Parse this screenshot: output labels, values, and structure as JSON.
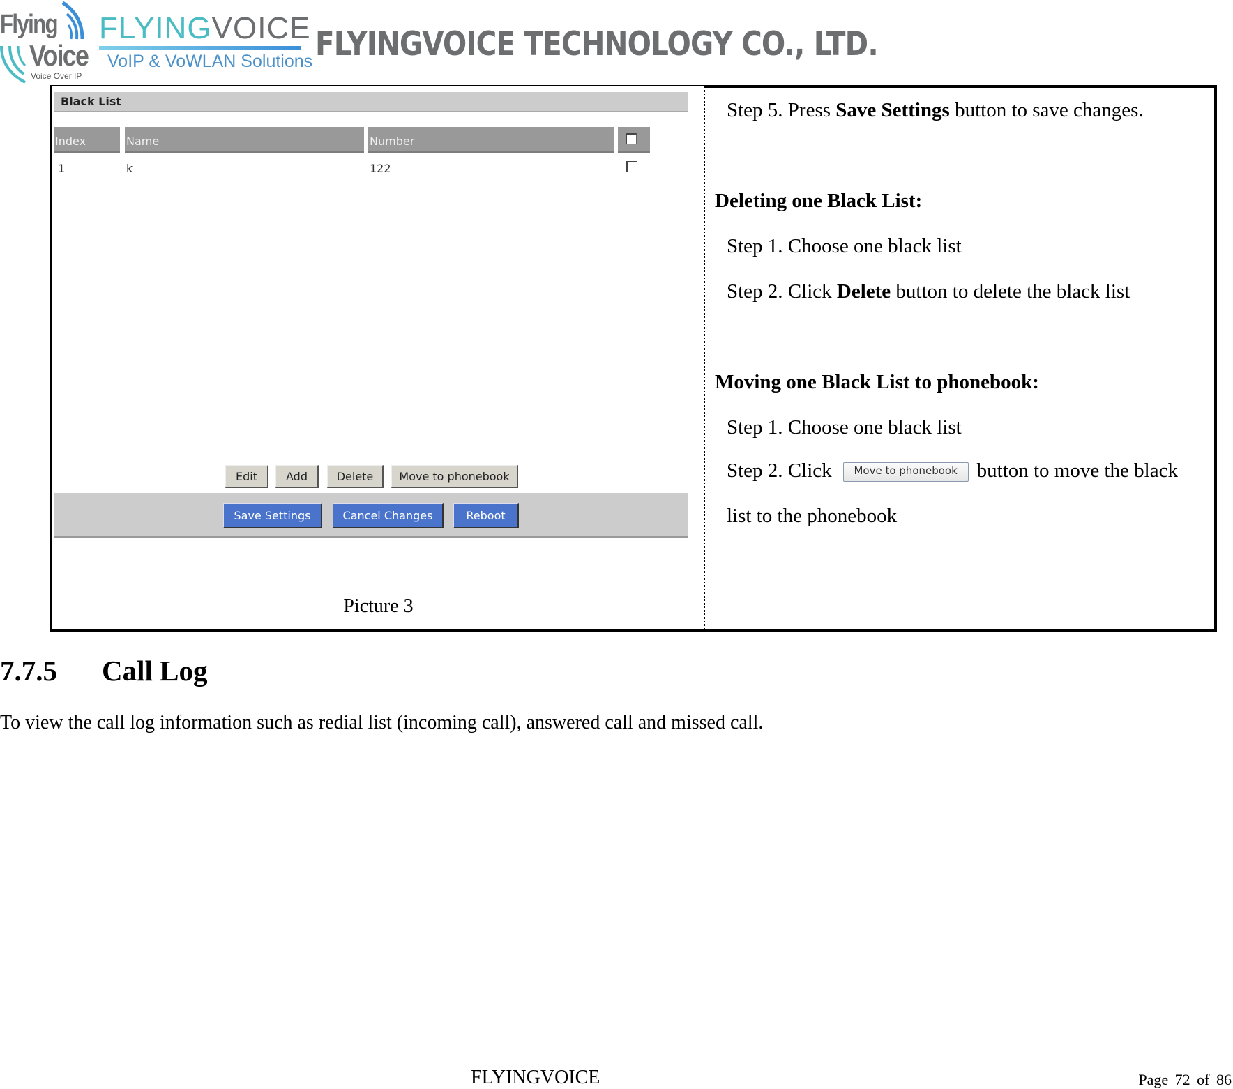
{
  "header": {
    "logo_mark": {
      "line1": "Flying",
      "line2": "Voice",
      "tagline": "Voice Over IP"
    },
    "logo_brand": {
      "part1": "FLYING",
      "part2": "VOICE",
      "tagline": "VoIP & VoWLAN Solutions"
    },
    "company_name": "FLYINGVOICE TECHNOLOGY CO., LTD.",
    "colors": {
      "teal": "#4bbcc4",
      "gray": "#6d6e70",
      "blue": "#4a90c9"
    }
  },
  "screenshot": {
    "title": "Black List",
    "columns": [
      "Index",
      "Name",
      "Number"
    ],
    "rows": [
      {
        "index": "1",
        "name": "k",
        "number": "122",
        "checked": false
      }
    ],
    "select_all_checked": false,
    "action_buttons": {
      "edit": "Edit",
      "add": "Add",
      "delete": "Delete",
      "move": "Move to phonebook"
    },
    "footer_buttons": {
      "save": "Save Settings",
      "cancel": "Cancel Changes",
      "reboot": "Reboot"
    },
    "caption": "Picture 3",
    "colors": {
      "blue_button": "#4a74cc",
      "gray_bar": "#cccccc",
      "header_cell": "#999999"
    }
  },
  "instructions": {
    "step5_prefix": "Step 5. Press ",
    "step5_bold": "Save Settings",
    "step5_suffix": " button to save changes.",
    "deleting_heading": "Deleting one Black List:",
    "del_step1": "Step 1. Choose one black list",
    "del_step2_prefix": "Step 2. Click ",
    "del_step2_bold": "Delete",
    "del_step2_suffix": " button to delete the black list",
    "moving_heading": "Moving one Black List to phonebook:",
    "move_step1": "Step 1. Choose one black list",
    "move_step2_prefix": "Step 2. Click",
    "move_inline_button": "Move to phonebook",
    "move_step2_suffix": "button to move the black",
    "move_step2_cont": "list to the phonebook"
  },
  "section": {
    "number": "7.7.5",
    "title": "Call Log",
    "body": "To view the call log information such as redial list (incoming call), answered call and missed call."
  },
  "footer": {
    "center": "FLYINGVOICE",
    "page_label": "Page",
    "page": "72",
    "of_label": "of",
    "total": "86"
  }
}
